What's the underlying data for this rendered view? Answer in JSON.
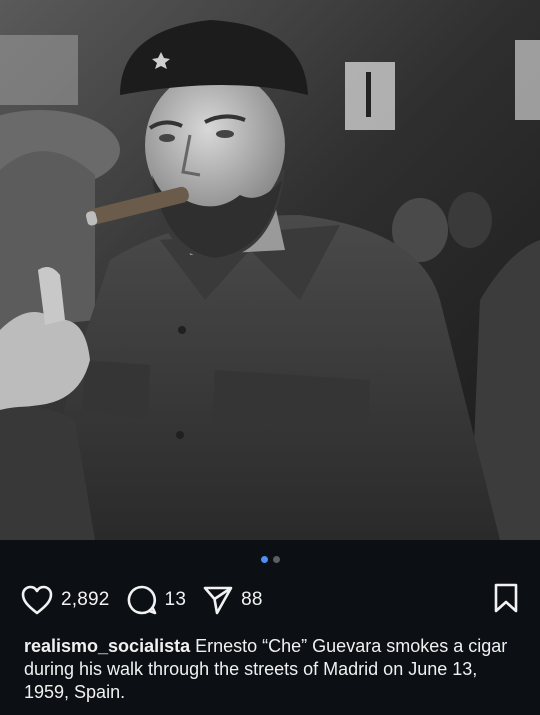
{
  "post": {
    "image_alt": "Black and white photograph of a bearded man in a black beret and military shirt smoking a cigar",
    "carousel": {
      "total": 2,
      "current": 1
    },
    "likes": "2,892",
    "comments": "13",
    "shares": "88",
    "username": "realismo_socialista",
    "caption": "Ernesto “Che” Guevara smokes a cigar during his walk through the streets of Madrid on June 13, 1959, Spain."
  },
  "icons": {
    "like": "heart-icon",
    "comment": "comment-bubble-icon",
    "share": "paper-plane-icon",
    "save": "bookmark-icon"
  },
  "colors": {
    "background": "#0c0f14",
    "carousel_active": "#4e8ef7",
    "carousel_inactive": "#5a5f66"
  }
}
